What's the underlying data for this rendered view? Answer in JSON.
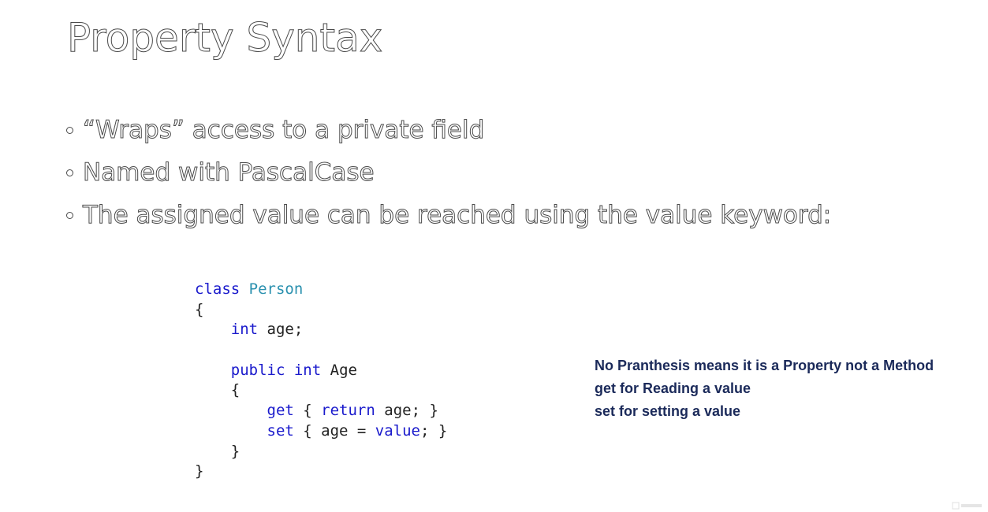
{
  "slide": {
    "title": "Property Syntax",
    "bullets": [
      "“Wraps” access to a private field",
      "Named with PascalCase",
      "The assigned value can be reached using the value keyword:"
    ]
  },
  "code": {
    "language": "C#",
    "lines": [
      [
        {
          "t": "class",
          "k": "kw"
        },
        {
          "t": " ",
          "k": "punct"
        },
        {
          "t": "Person",
          "k": "type"
        }
      ],
      [
        {
          "t": "{",
          "k": "punct"
        }
      ],
      [
        {
          "t": "    ",
          "k": "punct"
        },
        {
          "t": "int",
          "k": "kw"
        },
        {
          "t": " age;",
          "k": "ident"
        }
      ],
      [
        {
          "t": "",
          "k": "punct"
        }
      ],
      [
        {
          "t": "    ",
          "k": "punct"
        },
        {
          "t": "public",
          "k": "kw"
        },
        {
          "t": " ",
          "k": "punct"
        },
        {
          "t": "int",
          "k": "kw"
        },
        {
          "t": " Age",
          "k": "ident"
        }
      ],
      [
        {
          "t": "    {",
          "k": "punct"
        }
      ],
      [
        {
          "t": "        ",
          "k": "punct"
        },
        {
          "t": "get",
          "k": "kw"
        },
        {
          "t": " { ",
          "k": "punct"
        },
        {
          "t": "return",
          "k": "kw"
        },
        {
          "t": " age; }",
          "k": "ident"
        }
      ],
      [
        {
          "t": "        ",
          "k": "punct"
        },
        {
          "t": "set",
          "k": "kw"
        },
        {
          "t": " { age = ",
          "k": "ident"
        },
        {
          "t": "value",
          "k": "kw"
        },
        {
          "t": "; }",
          "k": "punct"
        }
      ],
      [
        {
          "t": "    }",
          "k": "punct"
        }
      ],
      [
        {
          "t": "}",
          "k": "punct"
        }
      ]
    ]
  },
  "notes": [
    "No Pranthesis means it is a Property not a Method",
    "get for Reading a value",
    "set for setting a value"
  ],
  "colors": {
    "keyword": "#1a1acc",
    "type_name": "#2b91af",
    "note_text": "#1b2a5a",
    "outline_stroke": "#4a4a4a"
  }
}
